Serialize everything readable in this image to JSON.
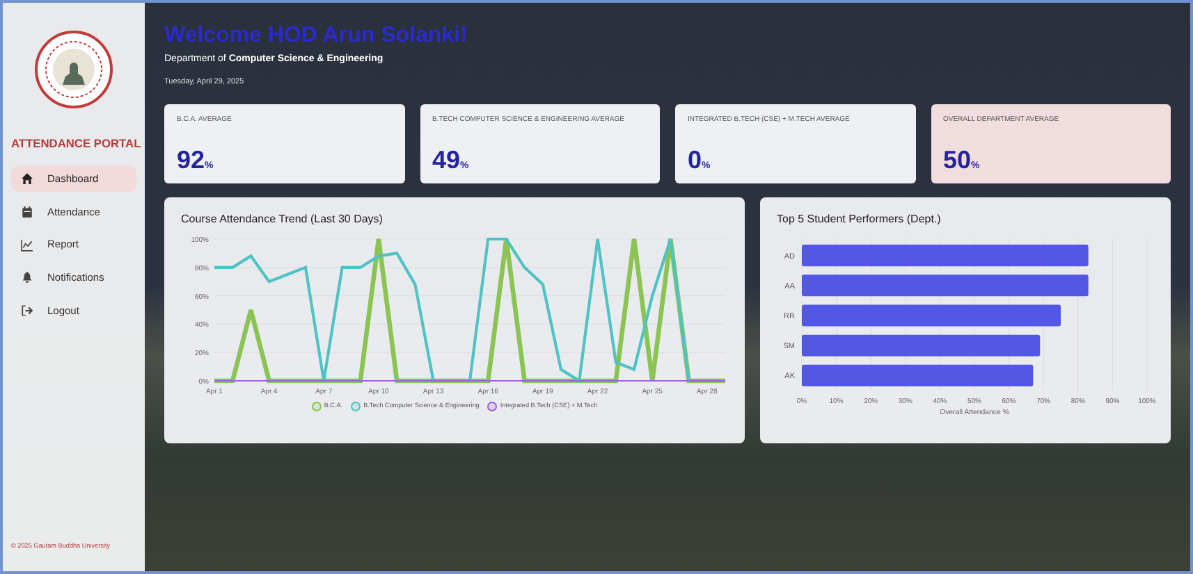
{
  "sidebar": {
    "title": "ATTENDANCE PORTAL",
    "items": [
      {
        "label": "Dashboard",
        "kind": "home",
        "selected": true
      },
      {
        "label": "Attendance",
        "kind": "calendar",
        "selected": false
      },
      {
        "label": "Report",
        "kind": "chart",
        "selected": false
      },
      {
        "label": "Notifications",
        "kind": "bell",
        "selected": false
      },
      {
        "label": "Logout",
        "kind": "logout",
        "selected": false
      }
    ],
    "footer": "© 2025 Gautam Buddha University"
  },
  "header": {
    "welcome": "Welcome HOD Arun Solanki!",
    "department": "Department of **Computer Science & Engineering**",
    "date": "Tuesday, April 29, 2025"
  },
  "stats": [
    {
      "label": "B.C.A. AVERAGE",
      "value": "92",
      "unit": "%",
      "highlighted": false
    },
    {
      "label": "B.TECH COMPUTER SCIENCE & ENGINEERING AVERAGE",
      "value": "49",
      "unit": "%",
      "highlighted": false
    },
    {
      "label": "INTEGRATED B.TECH (CSE) + M.TECH AVERAGE",
      "value": "0",
      "unit": "%",
      "highlighted": false
    },
    {
      "label": "OVERALL DEPARTMENT AVERAGE",
      "value": "50",
      "unit": "%",
      "highlighted": true
    }
  ],
  "charts": [
    {
      "title": "Course Attendance Trend (Last 30 Days)",
      "chart_data": {
        "type": "line",
        "grid": true,
        "categories": [
          "Apr 1",
          null,
          null,
          "Apr 4",
          null,
          null,
          "Apr 7",
          null,
          null,
          "Apr 10",
          null,
          null,
          "Apr 13",
          null,
          null,
          "Apr 16",
          null,
          null,
          "Apr 19",
          null,
          null,
          "Apr 22",
          null,
          null,
          "Apr 25",
          null,
          null,
          "Apr 28",
          null
        ],
        "series": [
          {
            "name": "B.C.A.",
            "color": "#8cc453",
            "values": [
              0,
              0,
              50,
              0,
              0,
              0,
              0,
              0,
              0,
              100,
              0,
              0,
              0,
              0,
              0,
              0,
              100,
              0,
              0,
              0,
              0,
              0,
              0,
              100,
              0,
              100,
              0,
              0,
              0
            ]
          },
          {
            "name": "B.Tech Computer Science & Engineering",
            "color": "#4fc3c3",
            "values": [
              80,
              80,
              88,
              70,
              75,
              80,
              0,
              80,
              80,
              88,
              90,
              68,
              0,
              0,
              0,
              100,
              100,
              80,
              68,
              8,
              0,
              100,
              13,
              8,
              60,
              100,
              0,
              0,
              0
            ]
          },
          {
            "name": "Integrated B.Tech (CSE) + M.Tech",
            "color": "#9b5fd8",
            "values": [
              0,
              0,
              0,
              0,
              0,
              0,
              0,
              0,
              0,
              0,
              0,
              0,
              0,
              0,
              0,
              0,
              0,
              0,
              0,
              0,
              0,
              0,
              0,
              0,
              0,
              0,
              0,
              0,
              0
            ]
          }
        ],
        "ylim": [
          0,
          100
        ],
        "yticks": [
          {
            "value": 0,
            "label": "0%"
          },
          {
            "value": 20,
            "label": "20%"
          },
          {
            "value": 40,
            "label": "40%"
          },
          {
            "value": 60,
            "label": "60%"
          },
          {
            "value": 80,
            "label": "80%"
          },
          {
            "value": 100,
            "label": "100%"
          }
        ]
      }
    },
    {
      "title": "Top 5 Student Performers (Dept.)",
      "chart_data": {
        "type": "bar",
        "orientation": "horizontal",
        "grid": true,
        "categories": [
          "AD",
          "AA",
          "RR",
          "SM",
          "AK"
        ],
        "series": [
          {
            "color": "#5257e6",
            "values": [
              83,
              83,
              75,
              69,
              67
            ]
          }
        ],
        "xlabel": "Overall Attendance %",
        "xlim": [
          0,
          100
        ],
        "xticks": [
          {
            "value": 0,
            "label": "0%"
          },
          {
            "value": 10,
            "label": "10%"
          },
          {
            "value": 20,
            "label": "20%"
          },
          {
            "value": 30,
            "label": "30%"
          },
          {
            "value": 40,
            "label": "40%"
          },
          {
            "value": 50,
            "label": "50%"
          },
          {
            "value": 60,
            "label": "60%"
          },
          {
            "value": 70,
            "label": "70%"
          },
          {
            "value": 80,
            "label": "80%"
          },
          {
            "value": 90,
            "label": "90%"
          },
          {
            "value": 100,
            "label": "100%"
          }
        ]
      }
    }
  ]
}
